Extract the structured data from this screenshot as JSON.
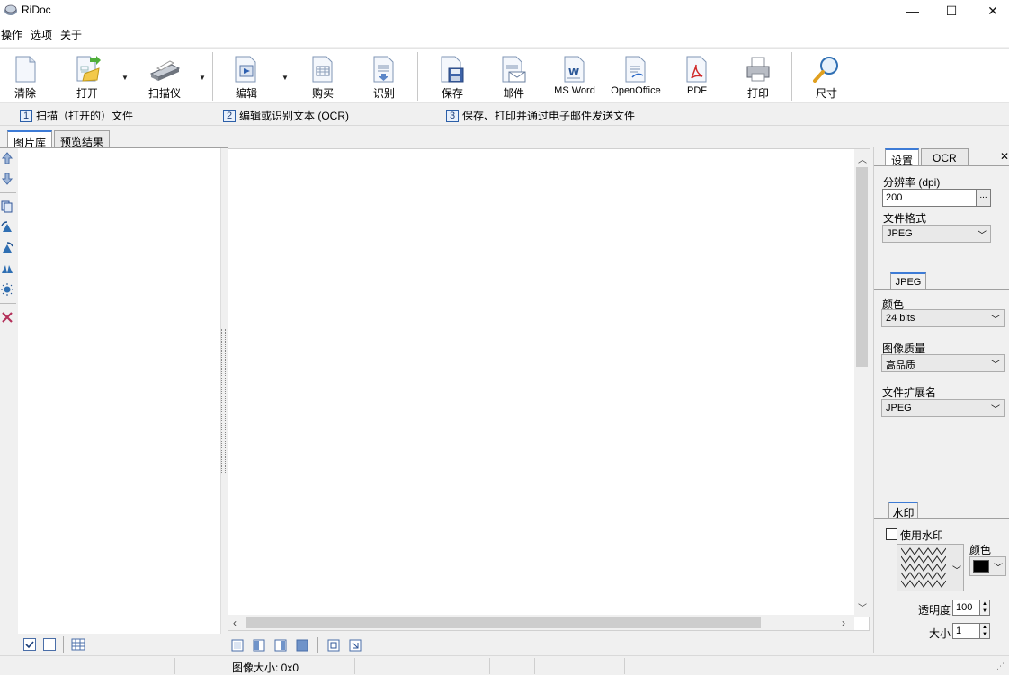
{
  "window": {
    "title": "RiDoc",
    "minimize": "—",
    "maximize": "☐",
    "close": "✕"
  },
  "menu": [
    "操作",
    "选项",
    "关于"
  ],
  "toolbar": {
    "clear": "清除",
    "open": "打开",
    "scanner": "扫描仪",
    "edit": "编辑",
    "buy": "购买",
    "recognize": "识别",
    "save": "保存",
    "mail": "邮件",
    "msword": "MS Word",
    "openoffice": "OpenOffice",
    "pdf": "PDF",
    "print": "打印",
    "size": "尺寸"
  },
  "steps": [
    {
      "num": "1",
      "label": "扫描（打开的）文件"
    },
    {
      "num": "2",
      "label": "编辑或识别文本 (OCR)"
    },
    {
      "num": "3",
      "label": "保存、打印并通过电子邮件发送文件"
    }
  ],
  "left_tabs": {
    "gallery": "图片库",
    "preview": "预览结果"
  },
  "settings": {
    "tab_settings": "设置",
    "tab_ocr": "OCR",
    "resolution_label": "分辨率 (dpi)",
    "resolution_value": "200",
    "browse": "...",
    "format_label": "文件格式",
    "format_value": "JPEG",
    "jpeg_tab": "JPEG",
    "color_label": "颜色",
    "color_value": "24 bits",
    "quality_label": "图像质量",
    "quality_value": "高品质",
    "ext_label": "文件扩展名",
    "ext_value": "JPEG",
    "watermark_tab": "水印",
    "use_watermark": "使用水印",
    "wm_color_label": "颜色",
    "wm_color_value": "#000000",
    "opacity_label": "透明度",
    "opacity_value": "100",
    "size_label": "大小",
    "size_value": "1"
  },
  "status": {
    "image_size": "图像大小: 0x0"
  }
}
